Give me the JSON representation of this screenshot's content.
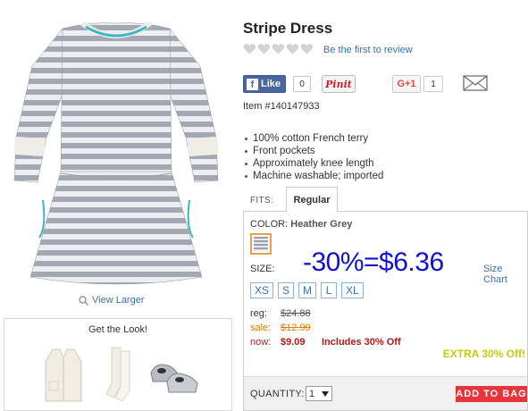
{
  "product": {
    "title": "Stripe Dress",
    "review_link": "Be the first to review",
    "item_number": "Item #140147933",
    "features": [
      "100% cotton French terry",
      "Front pockets",
      "Approximately knee length",
      "Machine washable; imported"
    ]
  },
  "gallery": {
    "view_larger": "View Larger"
  },
  "get_the_look": {
    "title": "Get the Look!"
  },
  "social": {
    "like_label": "Like",
    "like_count": "0",
    "pinit_label": "Pinit",
    "gplus_label": "G+1",
    "gplus_count": "1"
  },
  "fits": {
    "label": "FITS:",
    "selected": "Regular"
  },
  "options": {
    "color_label": "COLOR:",
    "color_value": "Heather Grey",
    "size_label": "SIZE:",
    "size_chart": "Size Chart",
    "sizes": [
      "XS",
      "S",
      "M",
      "L",
      "XL"
    ],
    "promo_overlay": "-30%=$6.36"
  },
  "pricing": {
    "reg_label": "reg:",
    "reg_value": "$24.88",
    "sale_label": "sale:",
    "sale_value": "$12.99",
    "now_label": "now:",
    "now_value": "$9.09",
    "now_note": "Includes 30% Off",
    "extra_off": "EXTRA 30% Off!"
  },
  "purchase": {
    "quantity_label": "QUANTITY:",
    "quantity_value": "1",
    "add_to_bag": "ADD TO BAG"
  },
  "colors": {
    "link": "#3a6fa6",
    "sale": "#e07b00",
    "now": "#b01a1a",
    "add_to_bag": "#e8343a",
    "extra_off": "#c9c90c",
    "promo_overlay": "#1010d0"
  }
}
